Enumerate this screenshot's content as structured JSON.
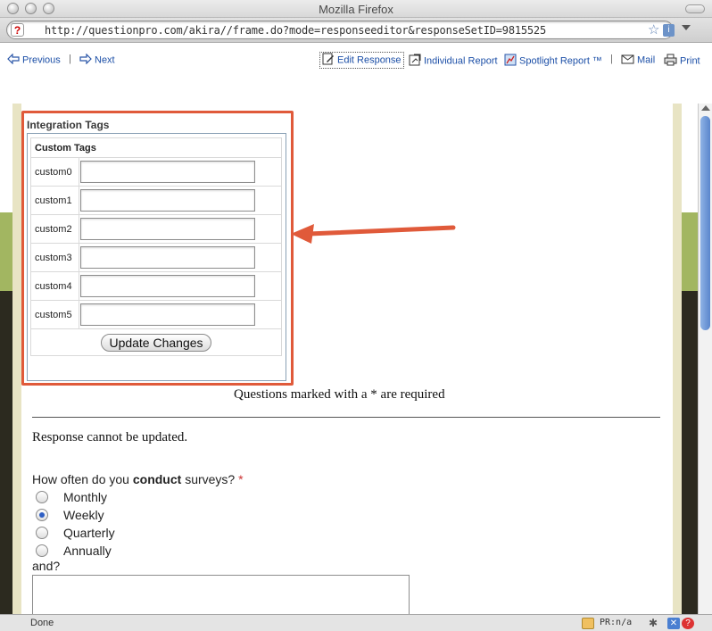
{
  "window": {
    "title": "Mozilla Firefox"
  },
  "urlbar": {
    "url": "http://questionpro.com/akira//frame.do?mode=responseeditor&responseSetID=9815525"
  },
  "nav": {
    "previous": "Previous",
    "next": "Next",
    "edit_response": "Edit Response",
    "individual_report": "Individual Report",
    "spotlight_report": "Spotlight Report ™",
    "mail": "Mail",
    "print": "Print"
  },
  "tags": {
    "title": "Integration Tags",
    "header": "Custom Tags",
    "fields": [
      {
        "label": "custom0",
        "value": ""
      },
      {
        "label": "custom1",
        "value": ""
      },
      {
        "label": "custom2",
        "value": ""
      },
      {
        "label": "custom3",
        "value": ""
      },
      {
        "label": "custom4",
        "value": ""
      },
      {
        "label": "custom5",
        "value": ""
      }
    ],
    "update_button": "Update Changes"
  },
  "survey": {
    "required_note": "Questions marked with a * are required",
    "cannot_update": "Response cannot be updated.",
    "question_prefix": "How often do you ",
    "question_bold": "conduct",
    "question_suffix": " surveys?",
    "required_marker": "*",
    "options": [
      {
        "label": "Monthly",
        "selected": false
      },
      {
        "label": "Weekly",
        "selected": true
      },
      {
        "label": "Quarterly",
        "selected": false
      },
      {
        "label": "Annually",
        "selected": false
      }
    ],
    "followup_label": "and?"
  },
  "status": {
    "text": "Done",
    "pagerank": "PR:n/a"
  },
  "colors": {
    "highlight": "#e05a3a",
    "link": "#1c4fa7",
    "header_green": "#a2b661",
    "header_dark": "#2c2a1f"
  }
}
